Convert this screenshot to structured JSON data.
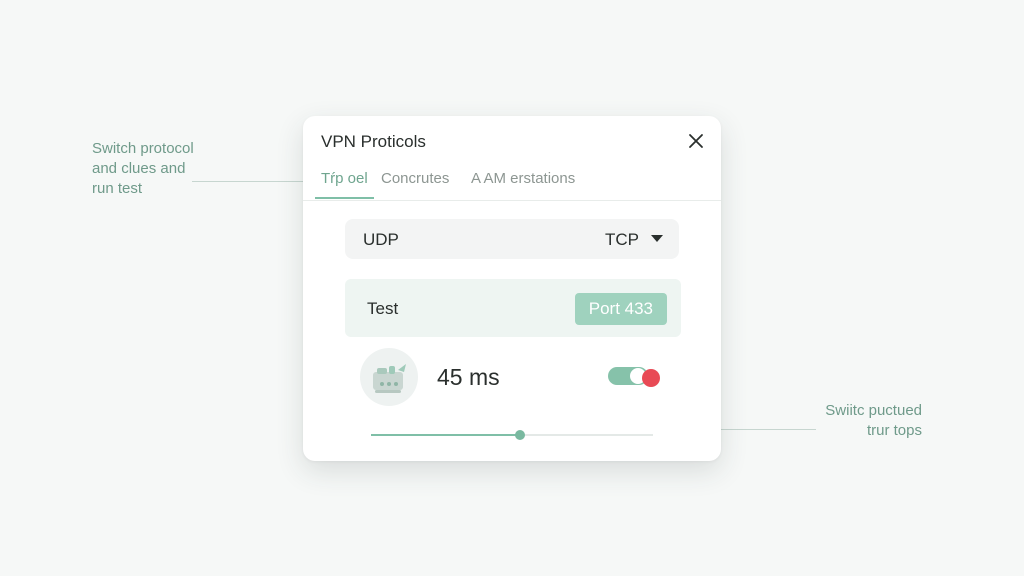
{
  "annotations": {
    "left": [
      "Switch protocol",
      "and clues and",
      "run test"
    ],
    "right": [
      "Swiitc puctued",
      "trur tops"
    ]
  },
  "dialog": {
    "title": "VPN Proticols",
    "close_icon": "close-icon",
    "tabs": [
      {
        "label": "Tŕp oel",
        "active": true
      },
      {
        "label": "Concrutes",
        "active": false
      },
      {
        "label": "A AM erstations",
        "active": false
      }
    ],
    "protocol": {
      "left": "UDP",
      "right": "TCP",
      "caret_icon": "caret-down-icon"
    },
    "test": {
      "label": "Test",
      "port": "Port 433"
    },
    "latency": "45 ms",
    "server_icon": "router-icon",
    "toggle": {
      "on": true
    },
    "slider": {
      "value": 0.53
    }
  },
  "colors": {
    "accent": "#7fbfa7",
    "badge": "#9fd2be",
    "alert": "#e84a55",
    "annotation": "#6f9a8a"
  }
}
